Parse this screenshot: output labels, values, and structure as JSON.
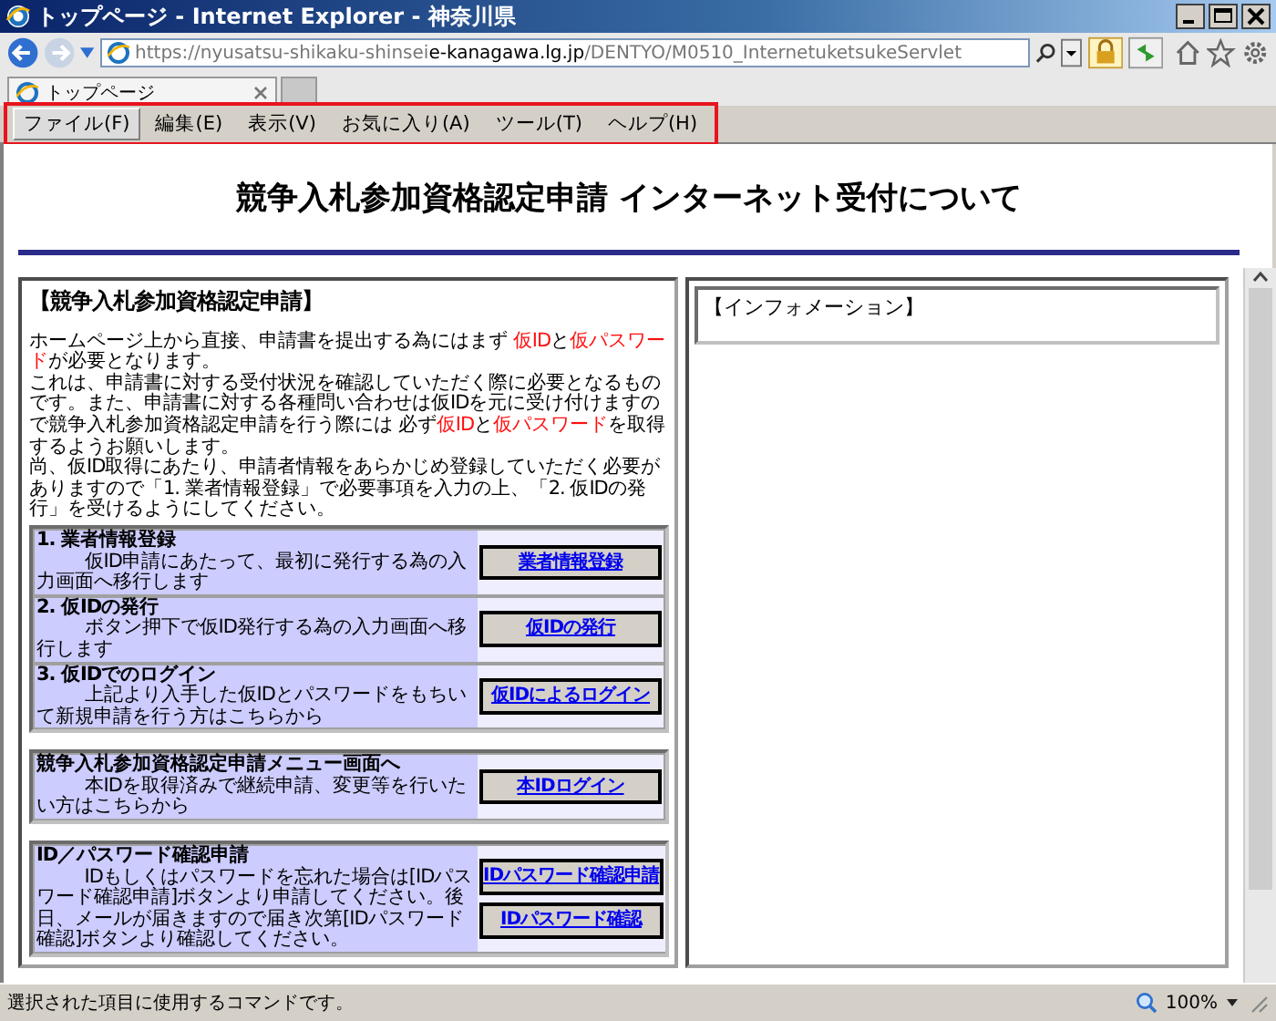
{
  "window": {
    "title": "トップページ - Internet Explorer - 神奈川県"
  },
  "address_bar": {
    "url_prefix": "https://nyusatsu-shikaku-shinsei",
    "url_domain": "e-kanagawa.lg.jp",
    "url_path": "/DENTYO/M0510_InternetuketsukeServlet"
  },
  "tabs": [
    {
      "label": "トップページ",
      "selected": true
    }
  ],
  "menu": {
    "highlighted": true,
    "items": [
      {
        "label": "ファイル(F)",
        "selected": true
      },
      {
        "label": "編集(E)",
        "selected": false
      },
      {
        "label": "表示(V)",
        "selected": false
      },
      {
        "label": "お気に入り(A)",
        "selected": false
      },
      {
        "label": "ツール(T)",
        "selected": false
      },
      {
        "label": "ヘルプ(H)",
        "selected": false
      }
    ]
  },
  "page": {
    "heading": "競争入札参加資格認定申請 インターネット受付について",
    "left_panel": {
      "title": "【競争入札参加資格認定申請】",
      "paragraphs": [
        [
          {
            "text": "ホームページ上から直接、申請書を提出する為にはまず ",
            "highlight": false
          },
          {
            "text": "仮ID",
            "highlight": true
          },
          {
            "text": "と",
            "highlight": false
          },
          {
            "text": "仮パスワード",
            "highlight": true
          },
          {
            "text": "が必要となります。",
            "highlight": false
          }
        ],
        [
          {
            "text": "これは、申請書に対する受付状況を確認していただく際に必要となるものです。また、申請書に対する各種問い合わせは仮IDを元に受け付けますので競争入札参加資格認定申請を行う際には 必ず",
            "highlight": false
          },
          {
            "text": "仮ID",
            "highlight": true
          },
          {
            "text": "と",
            "highlight": false
          },
          {
            "text": "仮パスワード",
            "highlight": true
          },
          {
            "text": "を取得するようお願いします。",
            "highlight": false
          }
        ],
        [
          {
            "text": "尚、仮ID取得にあたり、申請者情報をあらかじめ登録していただく必要がありますので「1. 業者情報登録」で必要事項を入力の上、「2. 仮IDの発行」を受けるようにしてください。",
            "highlight": false
          }
        ]
      ],
      "groups": [
        [
          {
            "title": "1. 業者情報登録",
            "description": "仮ID申請にあたって、最初に発行する為の入力画面へ移行します",
            "buttons": [
              "業者情報登録"
            ]
          },
          {
            "title": "2. 仮IDの発行",
            "description": "ボタン押下で仮ID発行する為の入力画面へ移行します",
            "buttons": [
              "仮IDの発行"
            ]
          },
          {
            "title": "3. 仮IDでのログイン",
            "description": "上記より入手した仮IDとパスワードをもちいて新規申請を行う方はこちらから",
            "buttons": [
              "仮IDによるログイン"
            ]
          }
        ],
        [
          {
            "title": "競争入札参加資格認定申請メニュー画面へ",
            "description": "本IDを取得済みで継続申請、変更等を行いたい方はこちらから",
            "buttons": [
              "本IDログイン"
            ]
          }
        ],
        [
          {
            "title": "ID／パスワード確認申請",
            "description": "IDもしくはパスワードを忘れた場合は[IDパスワード確認申請]ボタンより申請してください。後日、メールが届きますので届き次第[IDパスワード確認]ボタンより確認してください。",
            "buttons": [
              "IDパスワード確認申請",
              "IDパスワード確認"
            ]
          }
        ]
      ]
    },
    "right_panel": {
      "title": "【インフォメーション】"
    }
  },
  "status_bar": {
    "text": "選択された項目に使用するコマンドです。",
    "zoom": "100%"
  }
}
